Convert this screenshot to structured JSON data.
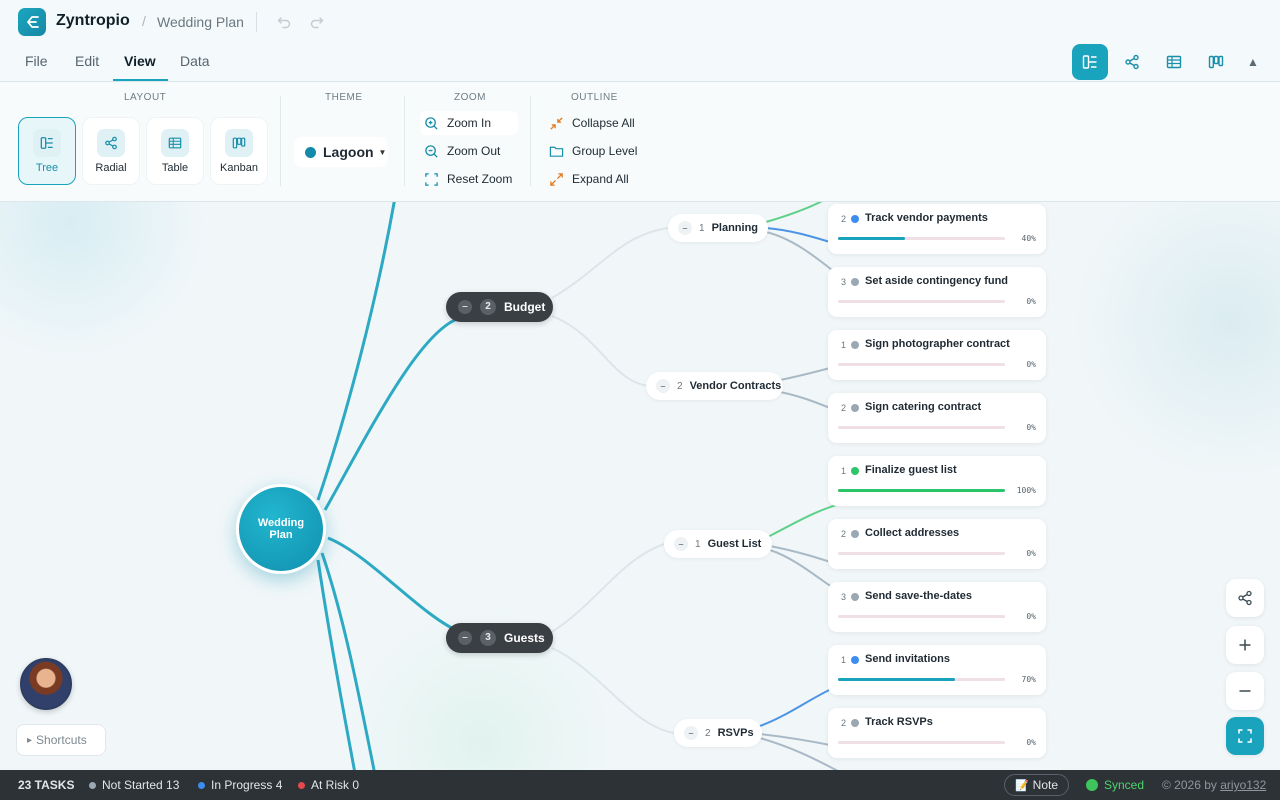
{
  "app": {
    "name": "Zyntropio",
    "separator": "/",
    "document": "Wedding Plan"
  },
  "menu": {
    "tabs": [
      "File",
      "Edit",
      "View",
      "Data"
    ],
    "active": "View"
  },
  "ribbon": {
    "layout": {
      "label": "LAYOUT",
      "options": [
        {
          "label": "Tree",
          "icon": "tree-icon",
          "active": true
        },
        {
          "label": "Radial",
          "icon": "radial-icon",
          "active": false
        },
        {
          "label": "Table",
          "icon": "table-icon",
          "active": false
        },
        {
          "label": "Kanban",
          "icon": "kanban-icon",
          "active": false
        }
      ]
    },
    "theme": {
      "label": "THEME",
      "value": "Lagoon",
      "color": "#138ba8"
    },
    "zoom": {
      "label": "ZOOM",
      "zoom_in": "Zoom In",
      "zoom_out": "Zoom Out",
      "reset": "Reset Zoom"
    },
    "outline": {
      "label": "OUTLINE",
      "collapse_all": "Collapse All",
      "group_level": "Group Level",
      "expand_all": "Expand All"
    }
  },
  "view_switcher": [
    "tree-view-icon",
    "share-icon",
    "table-view-icon",
    "kanban-view-icon"
  ],
  "mindmap": {
    "root": {
      "title": "Wedding Plan"
    },
    "branches": [
      {
        "collapse": "–",
        "index": "2",
        "title": "Budget"
      },
      {
        "collapse": "–",
        "index": "3",
        "title": "Guests"
      }
    ],
    "groups": [
      {
        "collapse": "–",
        "index": "1",
        "title": "Planning"
      },
      {
        "collapse": "–",
        "index": "2",
        "title": "Vendor Contracts"
      },
      {
        "collapse": "–",
        "index": "1",
        "title": "Guest List"
      },
      {
        "collapse": "–",
        "index": "2",
        "title": "RSVPs"
      }
    ],
    "tasks": [
      {
        "index": "2",
        "title": "Track vendor payments",
        "status": "in-progress",
        "progress": 40,
        "progress_label": "40%"
      },
      {
        "index": "3",
        "title": "Set aside contingency fund",
        "status": "not-started",
        "progress": 0,
        "progress_label": "0%"
      },
      {
        "index": "1",
        "title": "Sign photographer contract",
        "status": "not-started",
        "progress": 0,
        "progress_label": "0%"
      },
      {
        "index": "2",
        "title": "Sign catering contract",
        "status": "not-started",
        "progress": 0,
        "progress_label": "0%"
      },
      {
        "index": "1",
        "title": "Finalize guest list",
        "status": "done",
        "progress": 100,
        "progress_label": "100%"
      },
      {
        "index": "2",
        "title": "Collect addresses",
        "status": "not-started",
        "progress": 0,
        "progress_label": "0%"
      },
      {
        "index": "3",
        "title": "Send save-the-dates",
        "status": "not-started",
        "progress": 0,
        "progress_label": "0%"
      },
      {
        "index": "1",
        "title": "Send invitations",
        "status": "in-progress",
        "progress": 70,
        "progress_label": "70%"
      },
      {
        "index": "2",
        "title": "Track RSVPs",
        "status": "not-started",
        "progress": 0,
        "progress_label": "0%"
      }
    ]
  },
  "status_colors": {
    "not-started": "#9aa8b4",
    "in-progress": "#3b8ef0",
    "done": "#2cc56a",
    "at-risk": "#e5484d",
    "bar_fill": "#1aa3bd",
    "bar_done": "#2cc56a"
  },
  "shortcuts": {
    "label": "Shortcuts",
    "caret": "▸"
  },
  "status_bar": {
    "tasks": "23 TASKS",
    "not_started": "Not Started 13",
    "in_progress": "In Progress 4",
    "at_risk": "At Risk 0",
    "note": "Note",
    "synced": "Synced",
    "copyright_prefix": "© 2026 by",
    "author": "ariyo132"
  }
}
